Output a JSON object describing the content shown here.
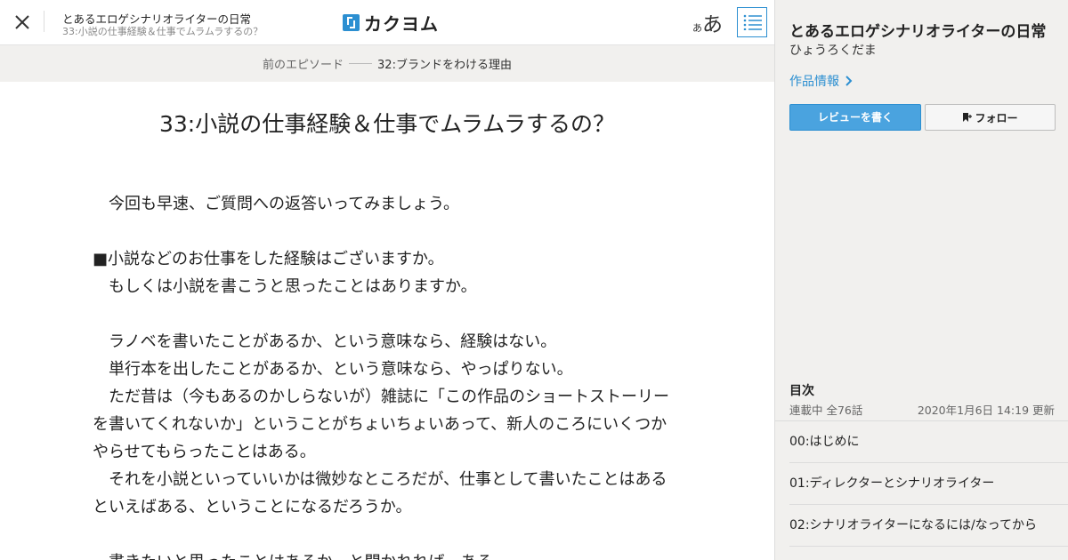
{
  "header": {
    "work_title": "とあるエロゲシナリオライターの日常",
    "episode_title": "33:小説の仕事経験＆仕事でムラムラするの？",
    "logo_text": "カクヨム",
    "font_small": "あ",
    "font_big": "あ"
  },
  "breadcrumb": {
    "prev_label": "前のエピソード",
    "current_episode": "32:ブランドをわける理由"
  },
  "episode": {
    "heading": "33:小説の仕事経験＆仕事でムラムラするの？",
    "paragraphs": [
      "　今回も早速、ご質問への返答いってみましょう。",
      "",
      "■小説などのお仕事をした経験はございますか。",
      "　もしくは小説を書こうと思ったことはありますか。",
      "",
      "　ラノベを書いたことがあるか、という意味なら、経験はない。",
      "　単行本を出したことがあるか、という意味なら、やっぱりない。",
      "　ただ昔は（今もあるのかしらないが）雑誌に「この作品のショートストーリー",
      "を書いてくれないか」ということがちょいちょいあって、新人のころにいくつか",
      "やらせてもらったことはある。",
      "　それを小説といっていいかは微妙なところだが、仕事として書いたことはある",
      "といえばある、ということになるだろうか。",
      "",
      "　書きたいと思ったことはあるか、と聞かれれば、ある。"
    ]
  },
  "sidebar": {
    "title": "とあるエロゲシナリオライターの日常",
    "author": "ひょうろくだま",
    "work_info_label": "作品情報",
    "review_button": "レビューを書く",
    "follow_button": "フォロー",
    "toc_heading": "目次",
    "toc_status": "連載中 全76話",
    "toc_updated": "2020年1月6日 14:19 更新",
    "toc_items": [
      "00:はじめに",
      "01:ディレクターとシナリオライター",
      "02:シナリオライターになるには/なってから"
    ]
  },
  "colors": {
    "accent": "#2c8fd1",
    "review_button_bg": "#4aa3df",
    "sidebar_bg": "#f1f0ee"
  },
  "icons": {
    "close": "close-icon",
    "toc": "list-icon",
    "chevron": "chevron-right-icon",
    "bookmark": "bookmark-plus-icon"
  }
}
